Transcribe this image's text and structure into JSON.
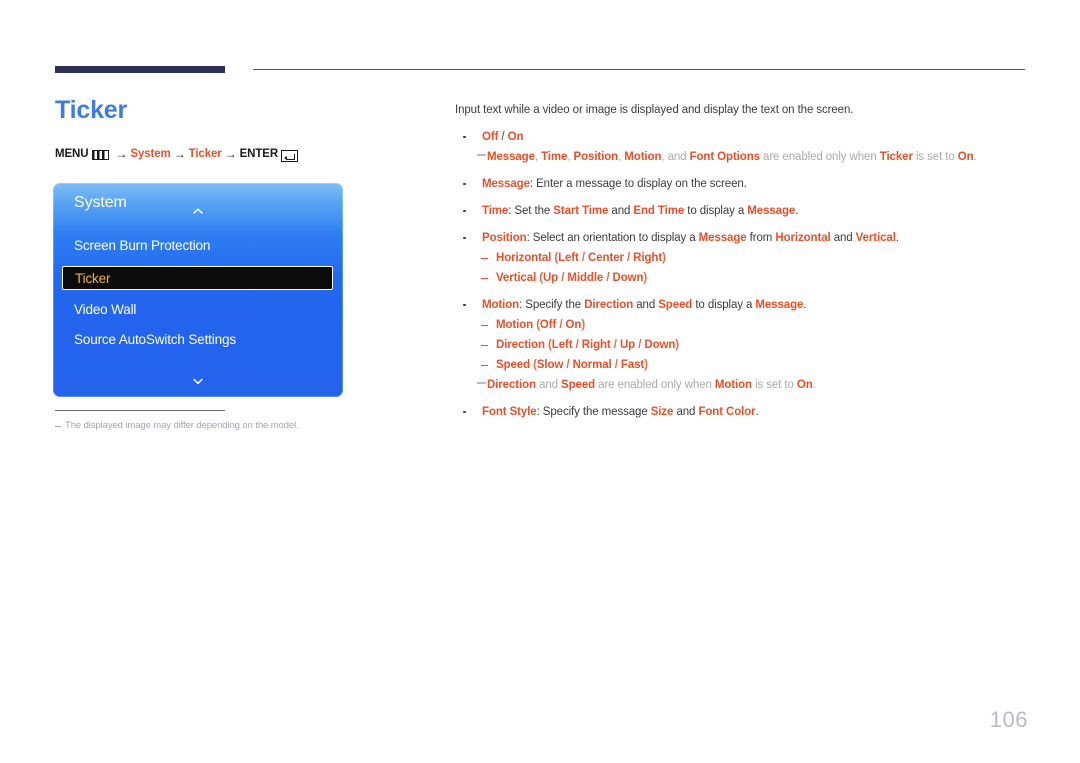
{
  "header": {
    "rule_color_thick": "#2e3157",
    "rule_color_thin": "#53557a"
  },
  "left": {
    "page_title": "Ticker",
    "menu_path": {
      "menu_label": "MENU",
      "menu_icon": "menu-grid-icon",
      "arrow": "→",
      "step1": "System",
      "step2": "Ticker",
      "enter_label": "ENTER",
      "enter_icon": "enter-return-icon"
    },
    "osd": {
      "title": "System",
      "chevron_up_icon": "chevron-up-icon",
      "chevron_down_icon": "chevron-down-icon",
      "items": [
        {
          "label": "Screen Burn Protection",
          "selected": false
        },
        {
          "label": "Ticker",
          "selected": true
        },
        {
          "label": "Video Wall",
          "selected": false
        },
        {
          "label": "Source AutoSwitch Settings",
          "selected": false
        }
      ],
      "selected_text_color": "#f2b72a",
      "panel_blue": "#2563ea"
    },
    "footnote": "The displayed image may differ depending on the model."
  },
  "right": {
    "intro": "Input text while a video or image is displayed and display the text on the screen.",
    "blocks": [
      {
        "type": "bullet",
        "parts": [
          {
            "t": "Off",
            "s": "r"
          },
          {
            "t": " / ",
            "s": "n"
          },
          {
            "t": "On",
            "s": "r"
          }
        ]
      },
      {
        "type": "note",
        "parts": [
          {
            "t": "Message",
            "s": "r"
          },
          {
            "t": ", ",
            "s": "g"
          },
          {
            "t": "Time",
            "s": "r"
          },
          {
            "t": ", ",
            "s": "g"
          },
          {
            "t": "Position",
            "s": "r"
          },
          {
            "t": ", ",
            "s": "g"
          },
          {
            "t": "Motion",
            "s": "r"
          },
          {
            "t": ", and ",
            "s": "g"
          },
          {
            "t": "Font Options",
            "s": "r"
          },
          {
            "t": " are enabled only when ",
            "s": "g"
          },
          {
            "t": "Ticker",
            "s": "r"
          },
          {
            "t": " is set to ",
            "s": "g"
          },
          {
            "t": "On",
            "s": "r"
          },
          {
            "t": ".",
            "s": "g"
          }
        ]
      },
      {
        "type": "bullet",
        "parts": [
          {
            "t": "Message",
            "s": "r"
          },
          {
            "t": ": Enter a message to display on the screen.",
            "s": "n"
          }
        ]
      },
      {
        "type": "bullet",
        "parts": [
          {
            "t": "Time",
            "s": "r"
          },
          {
            "t": ": Set the ",
            "s": "n"
          },
          {
            "t": "Start Time",
            "s": "r"
          },
          {
            "t": " and ",
            "s": "n"
          },
          {
            "t": "End Time",
            "s": "r"
          },
          {
            "t": " to display a ",
            "s": "n"
          },
          {
            "t": "Message",
            "s": "r"
          },
          {
            "t": ".",
            "s": "n"
          }
        ]
      },
      {
        "type": "bullet",
        "parts": [
          {
            "t": "Position",
            "s": "r"
          },
          {
            "t": ": Select an orientation to display a ",
            "s": "n"
          },
          {
            "t": "Message",
            "s": "r"
          },
          {
            "t": " from ",
            "s": "n"
          },
          {
            "t": "Horizontal",
            "s": "r"
          },
          {
            "t": " and ",
            "s": "n"
          },
          {
            "t": "Vertical",
            "s": "r"
          },
          {
            "t": ".",
            "s": "n"
          }
        ]
      },
      {
        "type": "subbullet",
        "parts": [
          {
            "t": "Horizontal",
            "s": "r"
          },
          {
            "t": " (",
            "s": "rl"
          },
          {
            "t": "Left",
            "s": "r"
          },
          {
            "t": " / ",
            "s": "rl"
          },
          {
            "t": "Center",
            "s": "r"
          },
          {
            "t": " / ",
            "s": "rl"
          },
          {
            "t": "Right",
            "s": "r"
          },
          {
            "t": ")",
            "s": "rl"
          }
        ]
      },
      {
        "type": "subbullet",
        "parts": [
          {
            "t": "Vertical",
            "s": "r"
          },
          {
            "t": " (",
            "s": "rl"
          },
          {
            "t": "Up",
            "s": "r"
          },
          {
            "t": " / ",
            "s": "rl"
          },
          {
            "t": "Middle",
            "s": "r"
          },
          {
            "t": " / ",
            "s": "rl"
          },
          {
            "t": "Down",
            "s": "r"
          },
          {
            "t": ")",
            "s": "rl"
          }
        ]
      },
      {
        "type": "bullet",
        "parts": [
          {
            "t": "Motion",
            "s": "r"
          },
          {
            "t": ": Specify the ",
            "s": "n"
          },
          {
            "t": "Direction",
            "s": "r"
          },
          {
            "t": " and ",
            "s": "n"
          },
          {
            "t": "Speed",
            "s": "r"
          },
          {
            "t": " to display a ",
            "s": "n"
          },
          {
            "t": "Message",
            "s": "r"
          },
          {
            "t": ".",
            "s": "n"
          }
        ]
      },
      {
        "type": "subbullet",
        "parts": [
          {
            "t": "Motion",
            "s": "r"
          },
          {
            "t": " (",
            "s": "rl"
          },
          {
            "t": "Off",
            "s": "r"
          },
          {
            "t": " / ",
            "s": "rl"
          },
          {
            "t": "On",
            "s": "r"
          },
          {
            "t": ")",
            "s": "rl"
          }
        ]
      },
      {
        "type": "subbullet",
        "parts": [
          {
            "t": "Direction",
            "s": "r"
          },
          {
            "t": " (",
            "s": "rl"
          },
          {
            "t": "Left",
            "s": "r"
          },
          {
            "t": " / ",
            "s": "rl"
          },
          {
            "t": "Right",
            "s": "r"
          },
          {
            "t": " / ",
            "s": "rl"
          },
          {
            "t": "Up",
            "s": "r"
          },
          {
            "t": " / ",
            "s": "rl"
          },
          {
            "t": "Down",
            "s": "r"
          },
          {
            "t": ")",
            "s": "rl"
          }
        ]
      },
      {
        "type": "subbullet",
        "parts": [
          {
            "t": "Speed",
            "s": "r"
          },
          {
            "t": " (",
            "s": "rl"
          },
          {
            "t": "Slow",
            "s": "r"
          },
          {
            "t": " / ",
            "s": "rl"
          },
          {
            "t": "Normal",
            "s": "r"
          },
          {
            "t": " / ",
            "s": "rl"
          },
          {
            "t": "Fast",
            "s": "r"
          },
          {
            "t": ")",
            "s": "rl"
          }
        ]
      },
      {
        "type": "note",
        "parts": [
          {
            "t": "Direction",
            "s": "r"
          },
          {
            "t": " and ",
            "s": "g"
          },
          {
            "t": "Speed",
            "s": "r"
          },
          {
            "t": " are enabled only when ",
            "s": "g"
          },
          {
            "t": "Motion",
            "s": "r"
          },
          {
            "t": " is set to ",
            "s": "g"
          },
          {
            "t": "On",
            "s": "r"
          },
          {
            "t": ".",
            "s": "g"
          }
        ]
      },
      {
        "type": "bullet",
        "parts": [
          {
            "t": "Font Style",
            "s": "r"
          },
          {
            "t": ": Specify the message ",
            "s": "n"
          },
          {
            "t": "Size",
            "s": "r"
          },
          {
            "t": " and ",
            "s": "n"
          },
          {
            "t": "Font Color",
            "s": "r"
          },
          {
            "t": ".",
            "s": "n"
          }
        ]
      }
    ]
  },
  "page_number": "106"
}
